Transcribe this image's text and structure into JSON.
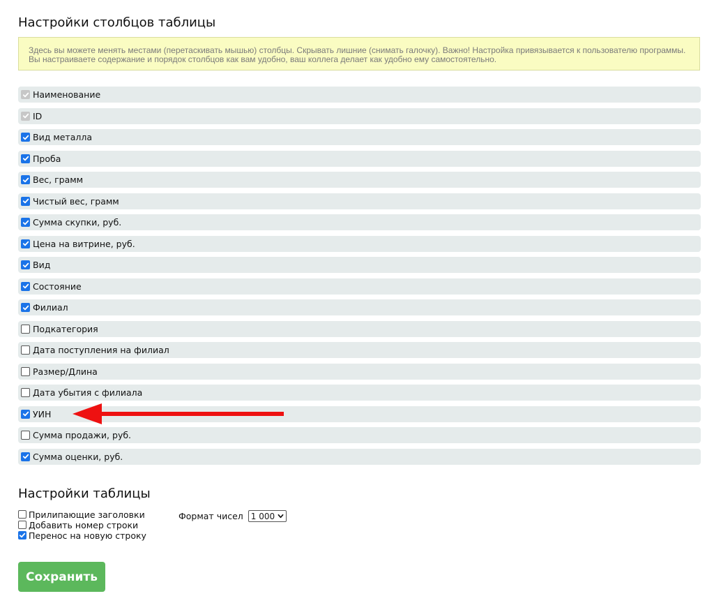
{
  "columns_section": {
    "title": "Настройки столбцов таблицы",
    "notice": "Здесь вы можете менять местами (перетаскивать мышью) столбцы. Скрывать лишние (снимать галочку). Важно! Настройка привязывается к пользователю программы. Вы настраиваете содержание и порядок столбцов как вам удобно, ваш коллега делает как удобно ему самостоятельно.",
    "items": [
      {
        "label": "Наименование",
        "state": "checked-disabled"
      },
      {
        "label": "ID",
        "state": "checked-disabled"
      },
      {
        "label": "Вид металла",
        "state": "checked"
      },
      {
        "label": "Проба",
        "state": "checked"
      },
      {
        "label": "Вес, грамм",
        "state": "checked"
      },
      {
        "label": "Чистый вес, грамм",
        "state": "checked"
      },
      {
        "label": "Сумма скупки, руб.",
        "state": "checked"
      },
      {
        "label": "Цена на витрине, руб.",
        "state": "checked"
      },
      {
        "label": "Вид",
        "state": "checked"
      },
      {
        "label": "Состояние",
        "state": "checked"
      },
      {
        "label": "Филиал",
        "state": "checked"
      },
      {
        "label": "Подкатегория",
        "state": "unchecked"
      },
      {
        "label": "Дата поступления на филиал",
        "state": "unchecked"
      },
      {
        "label": "Размер/Длина",
        "state": "unchecked"
      },
      {
        "label": "Дата убытия с филиала",
        "state": "unchecked"
      },
      {
        "label": "УИН",
        "state": "checked"
      },
      {
        "label": "Сумма продажи, руб.",
        "state": "unchecked"
      },
      {
        "label": "Сумма оценки, руб.",
        "state": "checked"
      }
    ]
  },
  "table_section": {
    "title": "Настройки таблицы",
    "options": [
      {
        "label": "Прилипающие заголовки",
        "state": "unchecked"
      },
      {
        "label": "Добавить номер строки",
        "state": "unchecked"
      },
      {
        "label": "Перенос на новую строку",
        "state": "checked"
      }
    ],
    "number_format": {
      "label": "Формат чисел",
      "selected": "1 000"
    }
  },
  "save_label": "Сохранить",
  "colors": {
    "checkbox_checked": "#1a73e8",
    "row_background": "#e5ebeb",
    "notice_background": "#fafcc2",
    "save_button": "#5cb85c",
    "annotation_arrow": "#ee1111"
  }
}
